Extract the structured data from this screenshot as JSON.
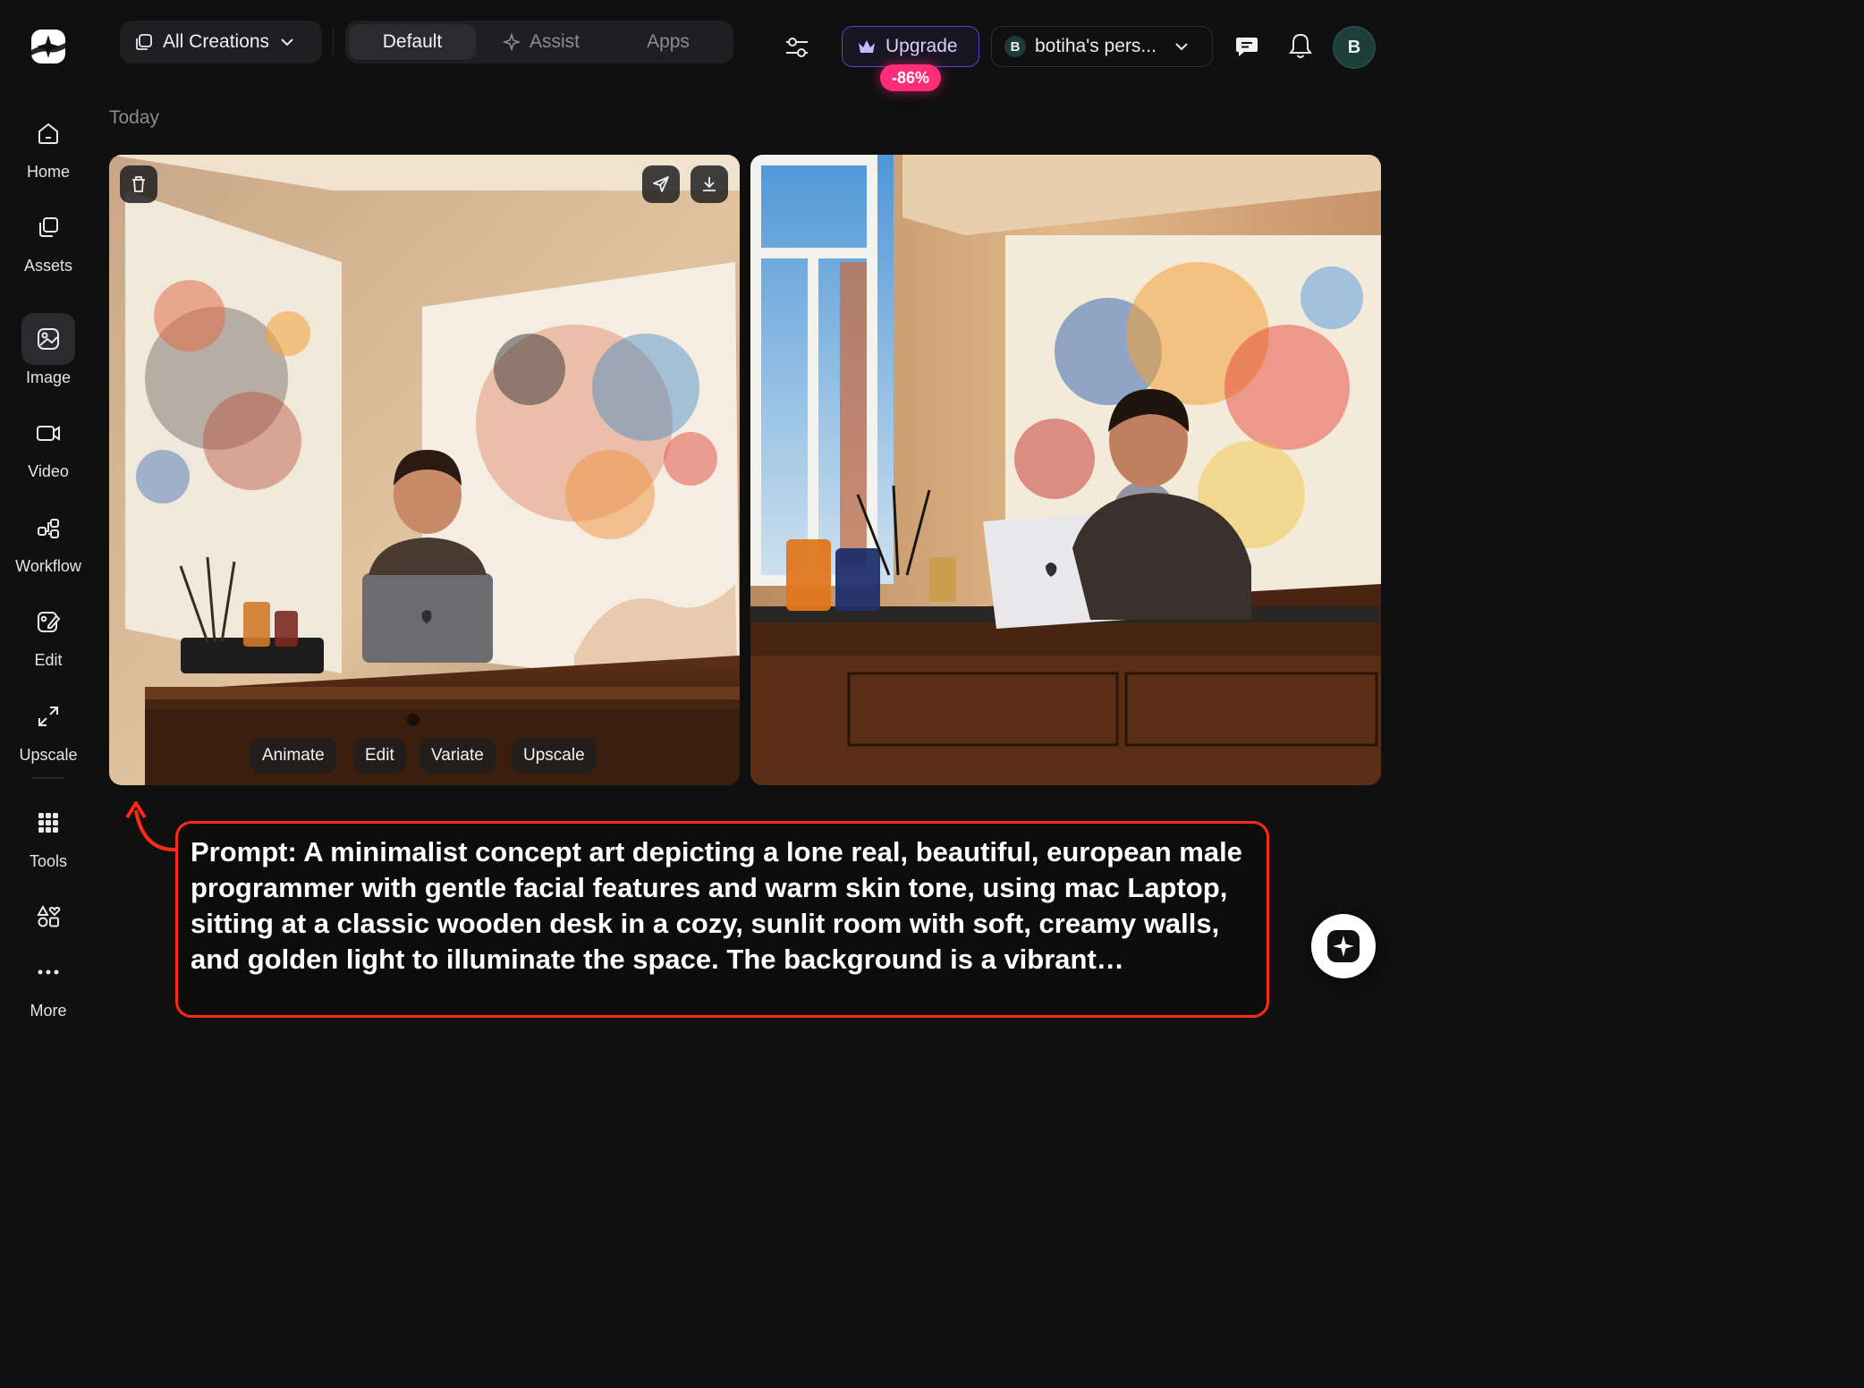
{
  "header": {
    "creations_label": "All Creations",
    "modes": [
      {
        "label": "Default",
        "active": true
      },
      {
        "label": "Assist",
        "active": false
      },
      {
        "label": "Apps",
        "active": false
      }
    ],
    "upgrade_label": "Upgrade",
    "discount_badge": "-86%",
    "workspace_initial": "B",
    "workspace_label": "botiha's pers...",
    "avatar_initial": "B"
  },
  "sidebar": {
    "items": [
      {
        "label": "Home",
        "icon": "home-icon"
      },
      {
        "label": "Assets",
        "icon": "assets-icon"
      },
      {
        "label": "Image",
        "icon": "image-icon",
        "active": true
      },
      {
        "label": "Video",
        "icon": "video-icon"
      },
      {
        "label": "Workflow",
        "icon": "workflow-icon"
      },
      {
        "label": "Edit",
        "icon": "edit-icon"
      },
      {
        "label": "Upscale",
        "icon": "upscale-icon"
      },
      {
        "label": "Tools",
        "icon": "grid-icon"
      },
      {
        "label": "More",
        "icon": "more-icon"
      }
    ]
  },
  "main": {
    "section_title": "Today",
    "image_actions": [
      "Animate",
      "Edit",
      "Variate",
      "Upscale"
    ]
  },
  "annotation": {
    "prompt": "Prompt: A minimalist concept art depicting a lone real, beautiful, european male programmer with gentle facial features and warm skin tone, using mac Laptop, sitting at a classic wooden desk in a cozy, sunlit room with soft, creamy walls, and golden light to illuminate the space. The background is a vibrant…"
  },
  "colors": {
    "background": "#101010",
    "accent": "#5b3fd6",
    "discount": "#ff2d78",
    "annotation_border": "#ff2a14"
  }
}
